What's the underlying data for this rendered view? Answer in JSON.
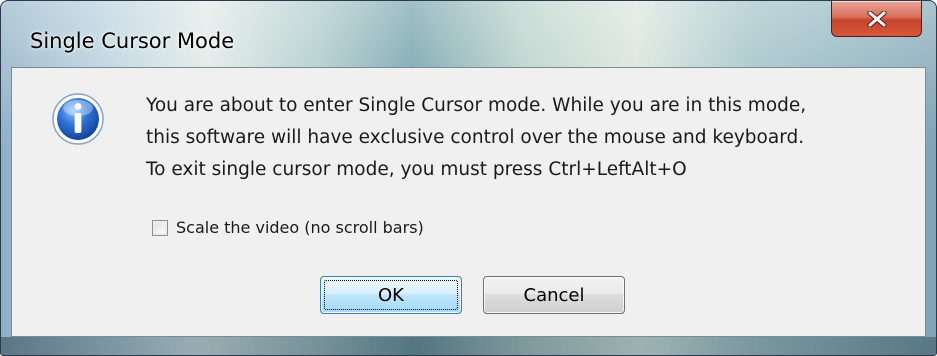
{
  "dialog": {
    "title": "Single Cursor Mode",
    "message_lines": [
      "You are about to enter Single Cursor mode.  While you are in this mode,",
      "this software will have exclusive control over the mouse and keyboard.",
      "To exit single cursor mode, you must press Ctrl+LeftAlt+O"
    ],
    "checkbox": {
      "label": "Scale the video (no scroll bars)",
      "checked": false
    },
    "buttons": {
      "ok_label": "OK",
      "cancel_label": "Cancel"
    },
    "icons": {
      "message_icon": "info-icon",
      "close_icon": "close-icon"
    },
    "colors": {
      "close_button": "#c7432c",
      "client_background": "#f0f0f0",
      "info_icon_blue": "#1f5fbf"
    }
  }
}
